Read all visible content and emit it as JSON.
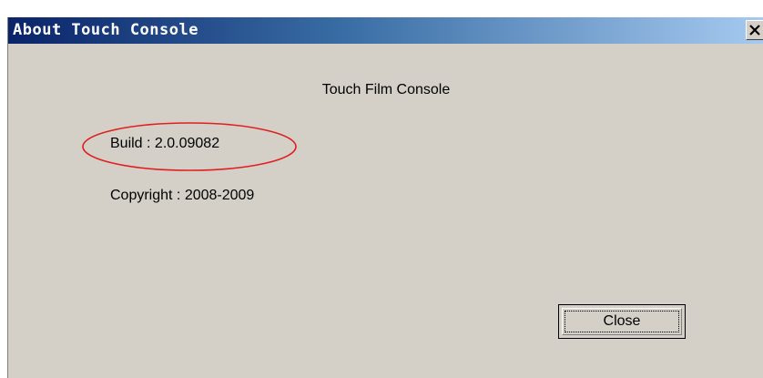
{
  "window": {
    "title": "About Touch Console",
    "close_glyph": "✕",
    "close_icon": "close-icon",
    "titlebar_colors": [
      "#0a246a",
      "#a6caf0"
    ],
    "body_color": "#d4d0c8"
  },
  "content": {
    "app_name": "Touch Film Console",
    "build": "Build : 2.0.09082",
    "copyright": "Copyright : 2008-2009"
  },
  "buttons": {
    "close_label": "Close"
  },
  "annotation": {
    "shape": "ellipse",
    "color": "#e02020",
    "target": "build"
  }
}
